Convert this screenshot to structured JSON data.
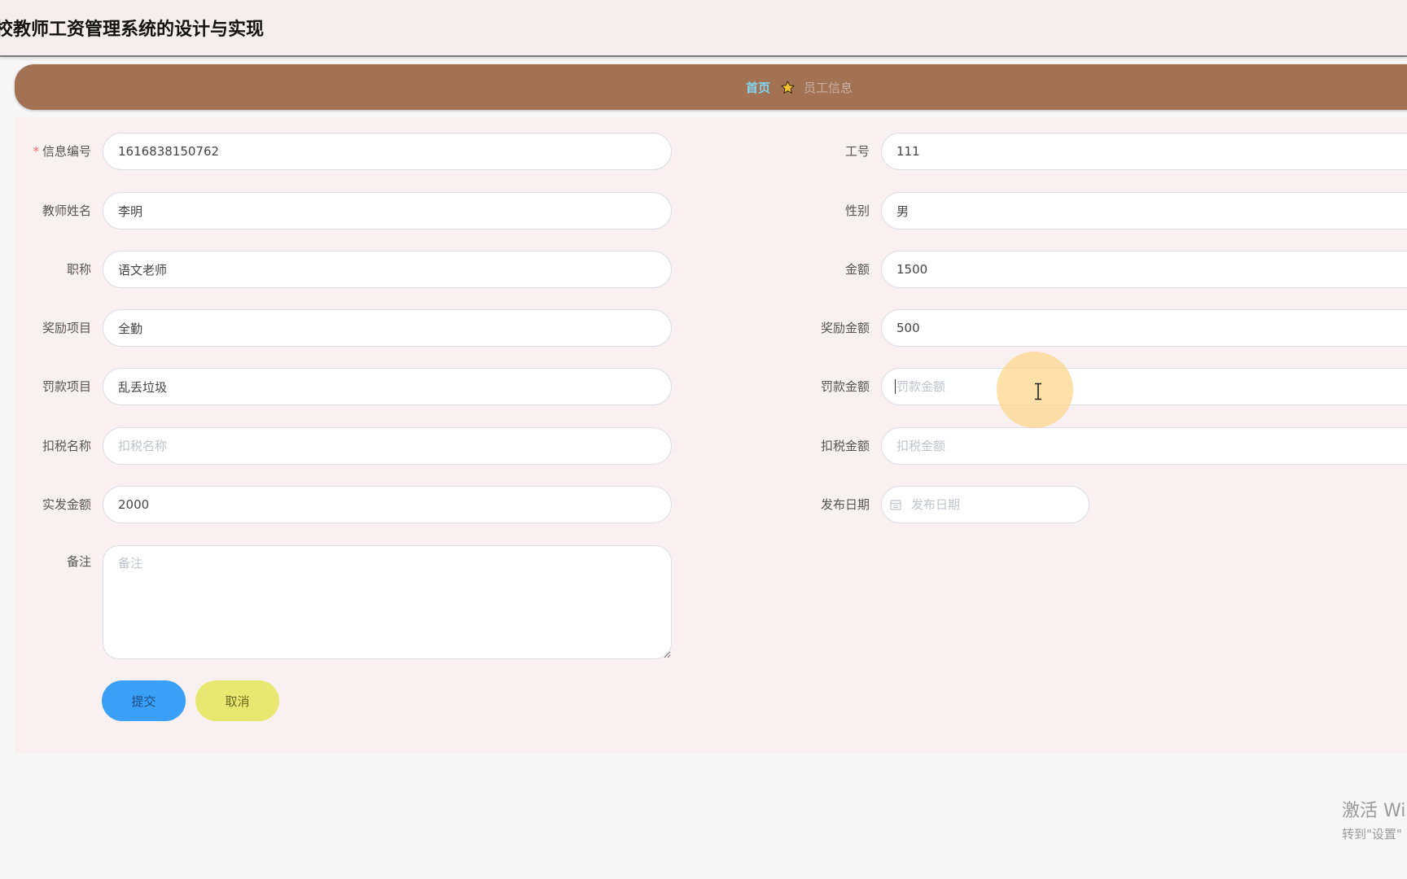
{
  "app": {
    "title": "校教师工资管理系统的设计与实现"
  },
  "breadcrumb": {
    "home": "首页",
    "current": "员工信息",
    "separator_icon": "star-icon"
  },
  "form": {
    "left": [
      {
        "key": "info_id",
        "label": "信息编号",
        "required": true,
        "value": "1616838150762",
        "placeholder": "信息编号"
      },
      {
        "key": "teacher_name",
        "label": "教师姓名",
        "value": "李明",
        "placeholder": "教师姓名"
      },
      {
        "key": "title",
        "label": "职称",
        "value": "语文老师",
        "placeholder": "职称"
      },
      {
        "key": "reward_item",
        "label": "奖励项目",
        "value": "全勤",
        "placeholder": "奖励项目"
      },
      {
        "key": "penalty_item",
        "label": "罚款项目",
        "value": "乱丢垃圾",
        "placeholder": "罚款项目"
      },
      {
        "key": "tax_name",
        "label": "扣税名称",
        "value": "",
        "placeholder": "扣税名称"
      },
      {
        "key": "net_amount",
        "label": "实发金额",
        "value": "2000",
        "placeholder": "实发金额"
      }
    ],
    "right": [
      {
        "key": "employee_no",
        "label": "工号",
        "value": "111",
        "placeholder": "工号"
      },
      {
        "key": "gender",
        "label": "性别",
        "value": "男",
        "placeholder": "性别"
      },
      {
        "key": "amount",
        "label": "金额",
        "value": "1500",
        "placeholder": "金额"
      },
      {
        "key": "reward_amount",
        "label": "奖励金额",
        "value": "500",
        "placeholder": "奖励金额"
      },
      {
        "key": "penalty_amount",
        "label": "罚款金额",
        "value": "",
        "placeholder": "罚款金额"
      },
      {
        "key": "tax_amount",
        "label": "扣税金额",
        "value": "",
        "placeholder": "扣税金额"
      }
    ],
    "publish_date": {
      "label": "发布日期",
      "value": "",
      "placeholder": "发布日期"
    },
    "remark": {
      "label": "备注",
      "value": "",
      "placeholder": "备注"
    },
    "buttons": {
      "submit": "提交",
      "cancel": "取消"
    }
  },
  "watermark": {
    "line1": "激活 Wi",
    "line2": "转到\"设置\""
  },
  "colors": {
    "breadcrumb_bar": "#a37154",
    "submit_button": "#3a9ff7",
    "cancel_button": "#e8e870",
    "required_mark": "#f56c6c",
    "crumb_home": "#7fd6ee"
  }
}
